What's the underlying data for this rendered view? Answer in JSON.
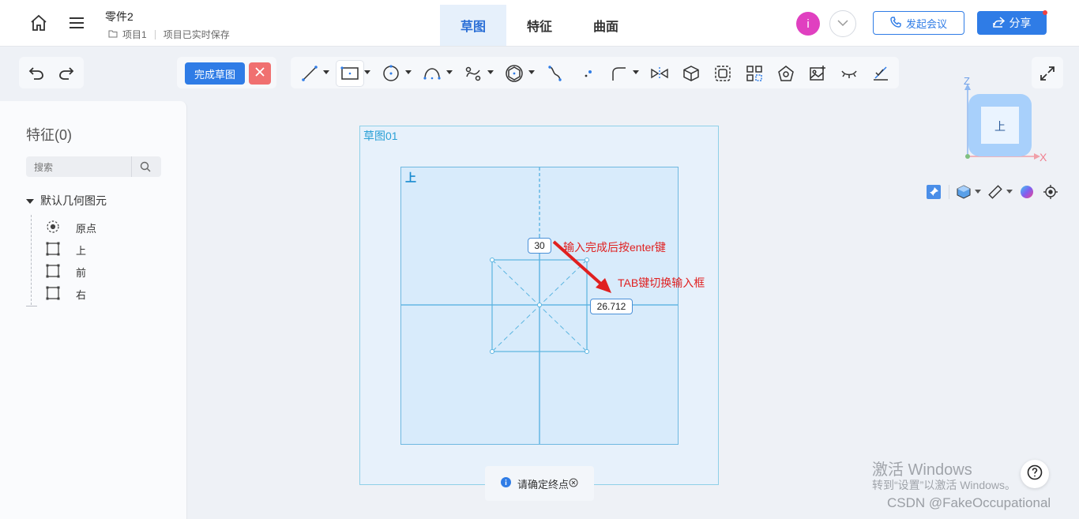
{
  "header": {
    "doc_title": "零件2",
    "project": "项目1",
    "save_status": "项目已实时保存",
    "tabs": [
      {
        "label": "草图",
        "active": true
      },
      {
        "label": "特征",
        "active": false
      },
      {
        "label": "曲面",
        "active": false
      }
    ],
    "avatar_letter": "i",
    "meeting_button": "发起会议",
    "share_button": "分享"
  },
  "toolbar": {
    "finish_sketch": "完成草图",
    "tools": [
      "line-icon",
      "rectangle-icon",
      "circle-icon",
      "arc-icon",
      "spline-icon",
      "polygon-icon",
      "curve-icon",
      "point-icon",
      "fillet-icon",
      "mirror-icon",
      "cube-icon",
      "offset-icon",
      "pattern-icon",
      "shape-icon",
      "image-icon",
      "hide-icon",
      "constraint-icon"
    ]
  },
  "left_panel": {
    "title": "特征(0)",
    "search_placeholder": "搜索",
    "tree_root": "默认几何图元",
    "items": [
      {
        "label": "原点",
        "icon": "origin-icon"
      },
      {
        "label": "上",
        "icon": "plane-icon"
      },
      {
        "label": "前",
        "icon": "plane-icon"
      },
      {
        "label": "右",
        "icon": "plane-icon"
      }
    ]
  },
  "canvas": {
    "sketch_label": "草图01",
    "plane_label": "上",
    "dim_height": "30",
    "dim_width": "26.712",
    "annotation_1": "输入完成后按enter键",
    "annotation_2": "TAB键切换输入框",
    "view_cube_face": "上",
    "axis_x": "X",
    "axis_z": "Z"
  },
  "status": {
    "message": "请确定终点"
  },
  "watermark": {
    "line1": "激活 Windows",
    "line2": "转到“设置”以激活 Windows。",
    "csdn": "CSDN @FakeOccupational"
  },
  "colors": {
    "primary": "#2f7ce6",
    "cancel": "#f07070",
    "annotation": "#e02020",
    "sketch": "#2aa0d6"
  }
}
